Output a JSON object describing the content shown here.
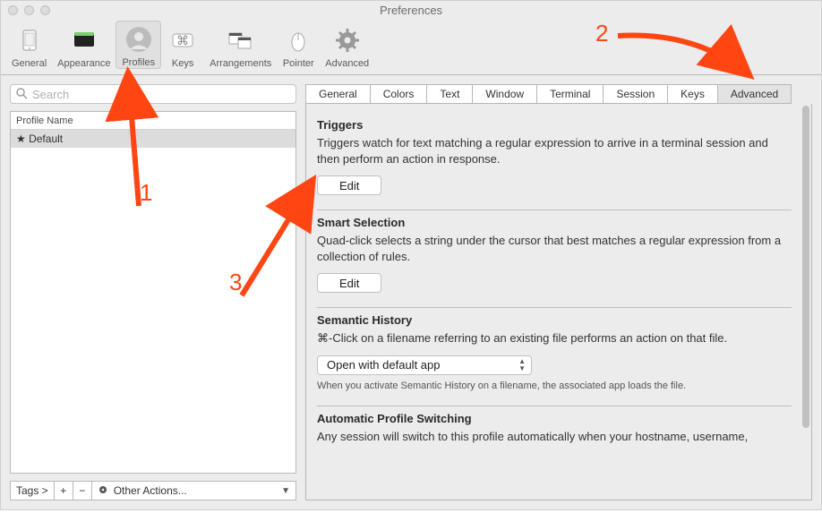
{
  "window": {
    "title": "Preferences"
  },
  "toolbar": {
    "items": [
      {
        "label": "General"
      },
      {
        "label": "Appearance"
      },
      {
        "label": "Profiles"
      },
      {
        "label": "Keys"
      },
      {
        "label": "Arrangements"
      },
      {
        "label": "Pointer"
      },
      {
        "label": "Advanced"
      }
    ],
    "selected_index": 2
  },
  "sidebar": {
    "search_placeholder": "Search",
    "column_header": "Profile Name",
    "profiles": [
      {
        "label": "★ Default",
        "selected": true
      }
    ],
    "bottom": {
      "tags_label": "Tags >",
      "add": "+",
      "remove": "−",
      "other_label": "Other Actions..."
    }
  },
  "subtabs": [
    {
      "label": "General"
    },
    {
      "label": "Colors"
    },
    {
      "label": "Text"
    },
    {
      "label": "Window"
    },
    {
      "label": "Terminal"
    },
    {
      "label": "Session"
    },
    {
      "label": "Keys"
    },
    {
      "label": "Advanced"
    }
  ],
  "subtabs_selected_index": 7,
  "sections": {
    "triggers": {
      "title": "Triggers",
      "desc": "Triggers watch for text matching a regular expression to arrive in a terminal session and then perform an action in response.",
      "button": "Edit"
    },
    "smart": {
      "title": "Smart Selection",
      "desc": "Quad-click selects a string under the cursor that best matches a regular expression from a collection of rules.",
      "button": "Edit"
    },
    "semantic": {
      "title": "Semantic History",
      "desc": "⌘-Click on a filename referring to an existing file performs an action on that file.",
      "select_value": "Open with default app",
      "note": "When you activate Semantic History on a filename, the associated app loads the file."
    },
    "autoprofile": {
      "title": "Automatic Profile Switching",
      "desc": "Any session will switch to this profile automatically when your hostname, username,"
    }
  },
  "annotations": {
    "n1": "1",
    "n2": "2",
    "n3": "3"
  }
}
